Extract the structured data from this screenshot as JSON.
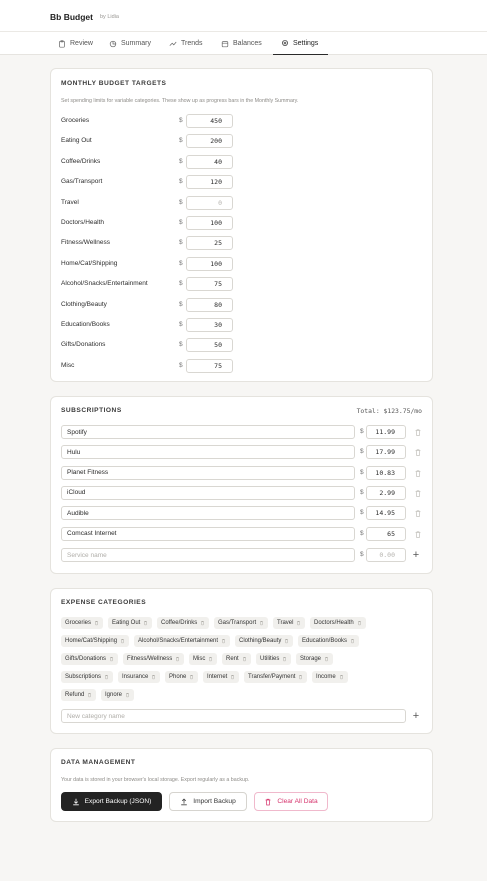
{
  "app": {
    "name": "Bb Budget",
    "byline": "by Lidia"
  },
  "tabs": [
    {
      "label": "Review",
      "icon": "clipboard-icon"
    },
    {
      "label": "Summary",
      "icon": "sliders-icon"
    },
    {
      "label": "Trends",
      "icon": "trend-icon"
    },
    {
      "label": "Balances",
      "icon": "wallet-icon"
    },
    {
      "label": "Settings",
      "icon": "gear-icon",
      "active": true
    }
  ],
  "budget": {
    "title": "MONTHLY BUDGET TARGETS",
    "description": "Set spending limits for variable categories. These show up as progress bars in the Monthly Summary.",
    "currency": "$",
    "rows": [
      {
        "label": "Groceries",
        "value": "450"
      },
      {
        "label": "Eating Out",
        "value": "200"
      },
      {
        "label": "Coffee/Drinks",
        "value": "40"
      },
      {
        "label": "Gas/Transport",
        "value": "120"
      },
      {
        "label": "Travel",
        "value": "",
        "placeholder": "0"
      },
      {
        "label": "Doctors/Health",
        "value": "100"
      },
      {
        "label": "Fitness/Wellness",
        "value": "25"
      },
      {
        "label": "Home/Cat/Shipping",
        "value": "100"
      },
      {
        "label": "Alcohol/Snacks/Entertainment",
        "value": "75"
      },
      {
        "label": "Clothing/Beauty",
        "value": "80"
      },
      {
        "label": "Education/Books",
        "value": "30"
      },
      {
        "label": "Gifts/Donations",
        "value": "50"
      },
      {
        "label": "Misc",
        "value": "75"
      }
    ]
  },
  "subscriptions": {
    "title": "SUBSCRIPTIONS",
    "total": "Total: $123.75/mo",
    "currency": "$",
    "items": [
      {
        "name": "Spotify",
        "amount": "11.99"
      },
      {
        "name": "Hulu",
        "amount": "17.99"
      },
      {
        "name": "Planet Fitness",
        "amount": "10.83"
      },
      {
        "name": "iCloud",
        "amount": "2.99"
      },
      {
        "name": "Audible",
        "amount": "14.95"
      },
      {
        "name": "Comcast Internet",
        "amount": "65"
      }
    ],
    "new_name_placeholder": "Service name",
    "new_amount_placeholder": "0.00",
    "add_label": "+"
  },
  "categories": {
    "title": "EXPENSE CATEGORIES",
    "items": [
      "Groceries",
      "Eating Out",
      "Coffee/Drinks",
      "Gas/Transport",
      "Travel",
      "Doctors/Health",
      "Home/Cat/Shipping",
      "Alcohol/Snacks/Entertainment",
      "Clothing/Beauty",
      "Education/Books",
      "Gifts/Donations",
      "Fitness/Wellness",
      "Misc",
      "Rent",
      "Utilities",
      "Storage",
      "Subscriptions",
      "Insurance",
      "Phone",
      "Internet",
      "Transfer/Payment",
      "Income",
      "Refund",
      "Ignore"
    ],
    "new_placeholder": "New category name",
    "add_label": "+"
  },
  "data_management": {
    "title": "DATA MANAGEMENT",
    "description": "Your data is stored in your browser's local storage. Export regularly as a backup.",
    "export_label": "Export Backup (JSON)",
    "import_label": "Import Backup",
    "clear_label": "Clear All Data"
  },
  "colors": {
    "accent_dark": "#232323",
    "danger": "#d6336c",
    "background": "#f7f6f4"
  }
}
